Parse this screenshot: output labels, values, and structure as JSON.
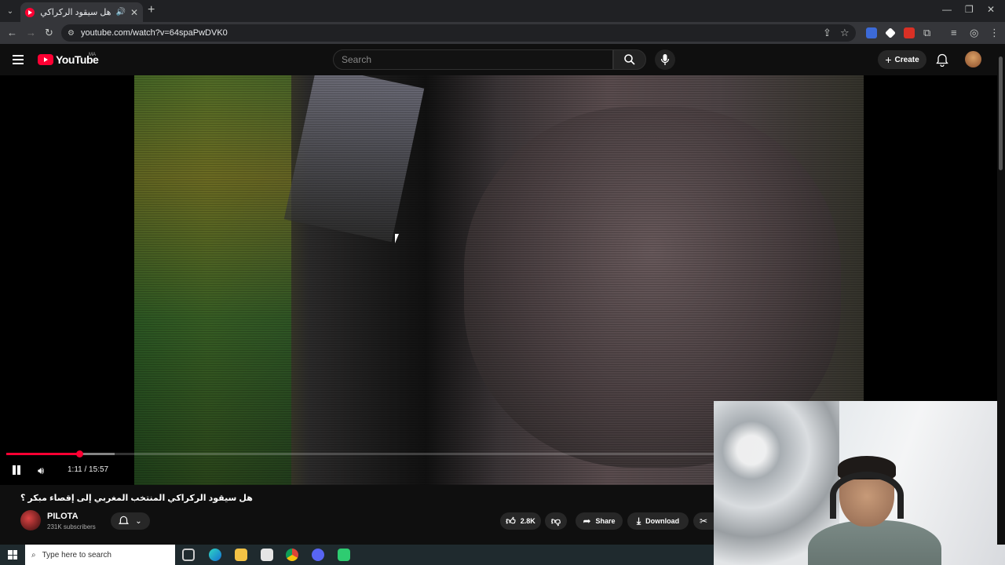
{
  "browser": {
    "tab_title": "هل سيقود الركراكي المنتخب",
    "url": "youtube.com/watch?v=64spaPwDVK0"
  },
  "youtube": {
    "logo_text": "YouTube",
    "country_code": "MA",
    "search_placeholder": "Search",
    "create_label": "Create"
  },
  "player": {
    "current_time": "1:11",
    "duration": "15:57",
    "time_display": "1:11 / 15:57",
    "progress_played": 0.074,
    "progress_buffered": 0.11,
    "state": "playing"
  },
  "video": {
    "title": "هل سيقود الركراكي المنتخب المغربي إلى إقصاء مبكر ؟",
    "channel_name": "PILOTA",
    "subscribers": "231K subscribers",
    "like_count": "2.8K",
    "share_label": "Share",
    "download_label": "Download"
  },
  "taskbar": {
    "search_placeholder": "Type here to search"
  },
  "colors": {
    "accent": "#ff0033",
    "background": "#0f0f0f"
  },
  "icons": [
    "menu-icon",
    "search-icon",
    "mic-icon",
    "bell-icon",
    "pause-icon",
    "volume-icon",
    "like-icon",
    "dislike-icon",
    "share-icon",
    "download-icon",
    "clip-icon"
  ]
}
